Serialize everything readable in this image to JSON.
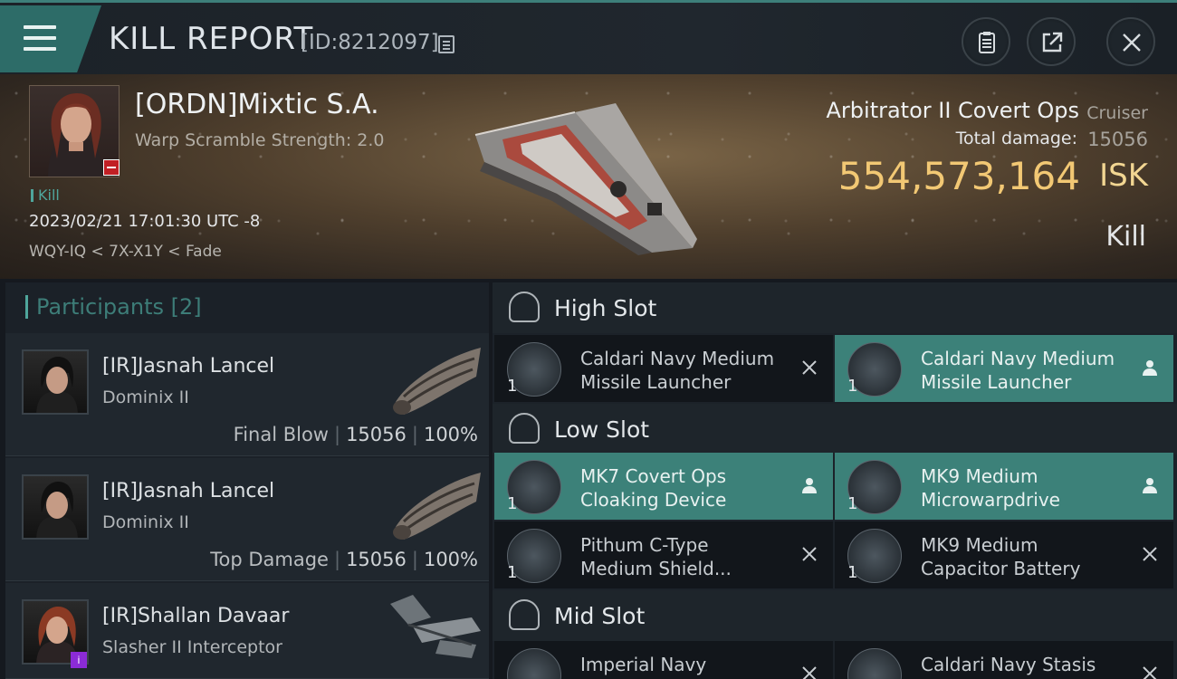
{
  "header": {
    "title": "KILL REPORT",
    "report_id": "[ID:8212097]"
  },
  "victim": {
    "name": "[ORDN]Mixtic S.A.",
    "warp_scramble": "Warp Scramble Strength: 2.0",
    "kill_tag": "Kill",
    "datetime": "2023/02/21 17:01:30 UTC -8",
    "location": "WQY-IQ < 7X-X1Y < Fade",
    "ship_name": "Arbitrator II Covert Ops",
    "ship_class": "Cruiser",
    "total_damage_label": "Total damage:",
    "total_damage": "15056",
    "isk_value": "554,573,164",
    "isk_unit": "ISK",
    "outcome": "Kill"
  },
  "participants": {
    "label": "Participants",
    "count": "[2]",
    "rows": [
      {
        "name": "[IR]Jasnah Lancel",
        "ship": "Dominix II",
        "role": "Final Blow",
        "damage": "15056",
        "percent": "100%"
      },
      {
        "name": "[IR]Jasnah Lancel",
        "ship": "Dominix II",
        "role": "Top Damage",
        "damage": "15056",
        "percent": "100%"
      },
      {
        "name": "[IR]Shallan Davaar",
        "ship": "Slasher II Interceptor",
        "role": "",
        "damage": "",
        "percent": ""
      }
    ]
  },
  "slots": {
    "high": {
      "label": "High Slot",
      "modules": [
        {
          "name_line1": "Caldari Navy Medium",
          "name_line2": "Missile Launcher",
          "qty": "1",
          "state": "destroyed"
        },
        {
          "name_line1": "Caldari Navy Medium",
          "name_line2": "Missile Launcher",
          "qty": "1",
          "state": "dropped"
        }
      ]
    },
    "low": {
      "label": "Low Slot",
      "modules": [
        {
          "name_line1": "MK7 Covert Ops",
          "name_line2": "Cloaking Device",
          "qty": "1",
          "state": "dropped"
        },
        {
          "name_line1": "MK9 Medium",
          "name_line2": "Microwarpdrive",
          "qty": "1",
          "state": "dropped"
        },
        {
          "name_line1": "Pithum C-Type",
          "name_line2": "Medium Shield...",
          "qty": "1",
          "state": "destroyed"
        },
        {
          "name_line1": "MK9 Medium",
          "name_line2": "Capacitor Battery",
          "qty": "1",
          "state": "destroyed"
        }
      ]
    },
    "mid": {
      "label": "Mid Slot",
      "modules": [
        {
          "name_line1": "Imperial Navy",
          "name_line2": "",
          "qty": "",
          "state": "destroyed"
        },
        {
          "name_line1": "Caldari Navy Stasis",
          "name_line2": "",
          "qty": "",
          "state": "destroyed"
        }
      ]
    }
  },
  "icons": {
    "menu": "hamburger-menu-icon",
    "copy": "copy-icon",
    "clipboard": "clipboard-icon",
    "share": "share-icon",
    "close": "close-icon",
    "slot": "slot-rack-icon",
    "destroyed": "x-mark-icon",
    "dropped": "person-icon"
  },
  "colors": {
    "accent": "#3c8179",
    "isk": "#f2c874",
    "victim_badge": "#c11f24",
    "participant_badge": "#8b2bd6"
  }
}
